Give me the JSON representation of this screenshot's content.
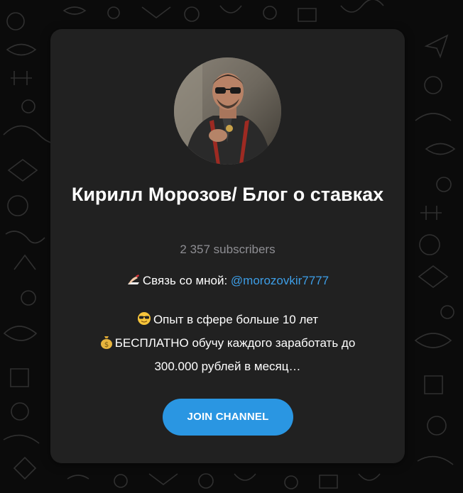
{
  "channel": {
    "title": "Кирилл Морозов/ Блог о ставках",
    "subscribers": "2 357 subscribers",
    "contact_prefix": "Связь со мной: ",
    "contact_link": "@morozovkir7777",
    "line_experience": "Опыт в сфере больше 10 лет",
    "line_free_1": "БЕСПЛАТНО обучу каждого заработать до",
    "line_free_2": "300.000 рублей в месяц…"
  },
  "actions": {
    "join_label": "JOIN CHANNEL"
  },
  "colors": {
    "accent": "#2a96e2",
    "link": "#3d9ee7",
    "card": "#212121",
    "background": "#0b0b0b"
  }
}
